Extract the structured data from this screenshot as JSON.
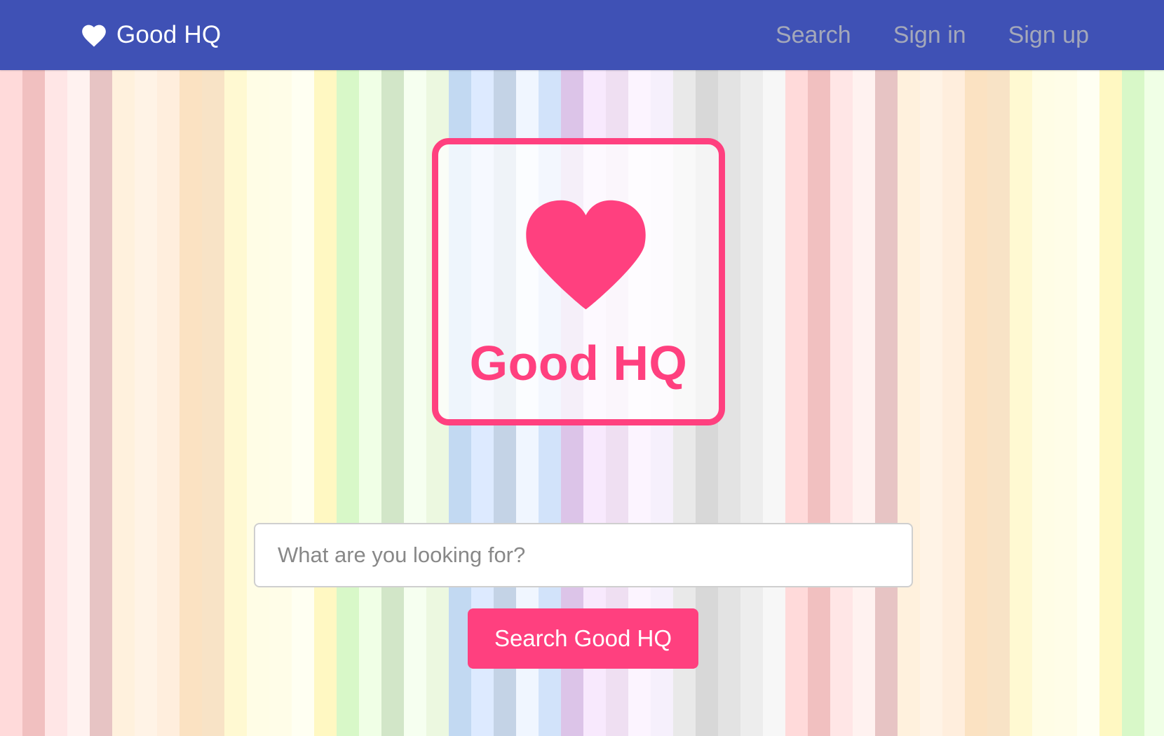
{
  "navbar": {
    "brand_label": "Good HQ",
    "brand_icon": "heart-icon",
    "links": {
      "search": "Search",
      "sign_in": "Sign in",
      "sign_up": "Sign up"
    },
    "background_color": "#3f51b5"
  },
  "hero": {
    "logo_text": "Good HQ",
    "logo_icon": "heart-icon",
    "accent_color": "#ff407f"
  },
  "search": {
    "placeholder": "What are you looking for?",
    "value": "",
    "button_label": "Search Good HQ"
  },
  "background": {
    "stripe_colors": [
      "#ffdada",
      "#f1c0c0",
      "#ffe6e6",
      "#fff2f0",
      "#e7c4c4",
      "#fff1dd",
      "#fff3e6",
      "#ffeedd",
      "#fbe2c2",
      "#f8e3c6",
      "#fff9d2",
      "#fffde6",
      "#fffde8",
      "#fffff2",
      "#fff8c2",
      "#d8f8c8",
      "#f0ffe6",
      "#d2e6c8",
      "#f6fff0",
      "#ecf8e0",
      "#c2d9f2",
      "#ddeaff",
      "#c4d3e6",
      "#f0f6ff",
      "#d2e3fa",
      "#dcc4e8",
      "#f8e9fd",
      "#efdff2",
      "#fcf4ff",
      "#f6f0fc",
      "#e9e9e9",
      "#d8d8d8",
      "#e3e3e3",
      "#ededed",
      "#f7f7f7",
      "#ffdada",
      "#f1c0c0",
      "#ffe6e6",
      "#fff2f0",
      "#e7c4c4",
      "#fff1dd",
      "#fff3e6",
      "#ffeedd",
      "#fbe2c2",
      "#f8e3c6",
      "#fff9d2",
      "#fffde6",
      "#fffde8",
      "#fffff2",
      "#fff8c2",
      "#d8f8c8",
      "#f0ffe6"
    ]
  }
}
